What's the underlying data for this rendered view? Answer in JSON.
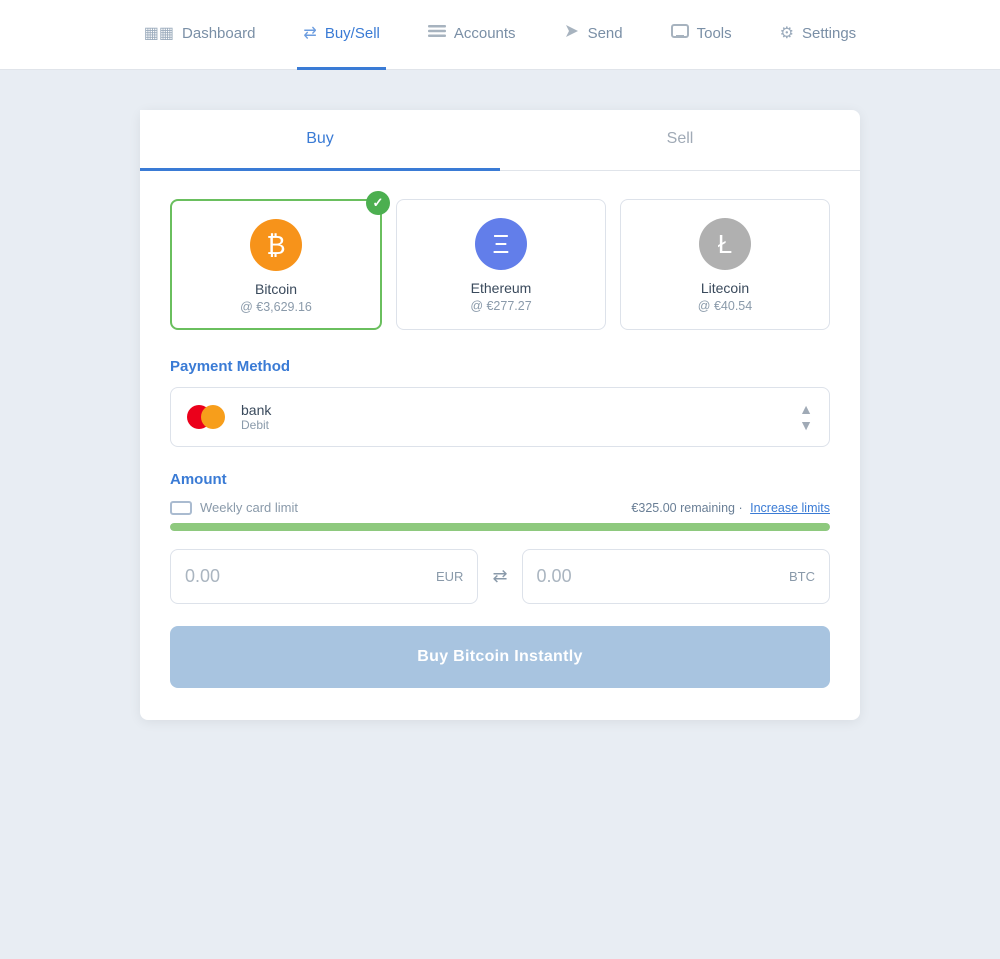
{
  "navbar": {
    "items": [
      {
        "id": "dashboard",
        "label": "Dashboard",
        "icon": "⊞",
        "active": false
      },
      {
        "id": "buysell",
        "label": "Buy/Sell",
        "icon": "⇄",
        "active": true
      },
      {
        "id": "accounts",
        "label": "Accounts",
        "icon": "☰",
        "active": false
      },
      {
        "id": "send",
        "label": "Send",
        "icon": "➤",
        "active": false
      },
      {
        "id": "tools",
        "label": "Tools",
        "icon": "🖥",
        "active": false
      },
      {
        "id": "settings",
        "label": "Settings",
        "icon": "⚙",
        "active": false
      }
    ]
  },
  "tabs": [
    {
      "id": "buy",
      "label": "Buy",
      "active": true
    },
    {
      "id": "sell",
      "label": "Sell",
      "active": false
    }
  ],
  "crypto": {
    "options": [
      {
        "id": "btc",
        "name": "Bitcoin",
        "price": "@ €3,629.16",
        "symbol": "₿",
        "selected": true
      },
      {
        "id": "eth",
        "name": "Ethereum",
        "price": "@ €277.27",
        "symbol": "Ξ",
        "selected": false
      },
      {
        "id": "ltc",
        "name": "Litecoin",
        "price": "@ €40.54",
        "symbol": "Ł",
        "selected": false
      }
    ]
  },
  "payment": {
    "section_title": "Payment Method",
    "name": "bank",
    "type": "Debit"
  },
  "amount": {
    "section_title": "Amount",
    "limit_label": "Weekly card limit",
    "remaining": "€325.00 remaining",
    "dot": "·",
    "increase_link": "Increase limits",
    "progress_pct": 100,
    "eur_value": "0.00",
    "eur_unit": "EUR",
    "btc_value": "0.00",
    "btc_unit": "BTC"
  },
  "buy_button": {
    "label": "Buy Bitcoin Instantly"
  }
}
